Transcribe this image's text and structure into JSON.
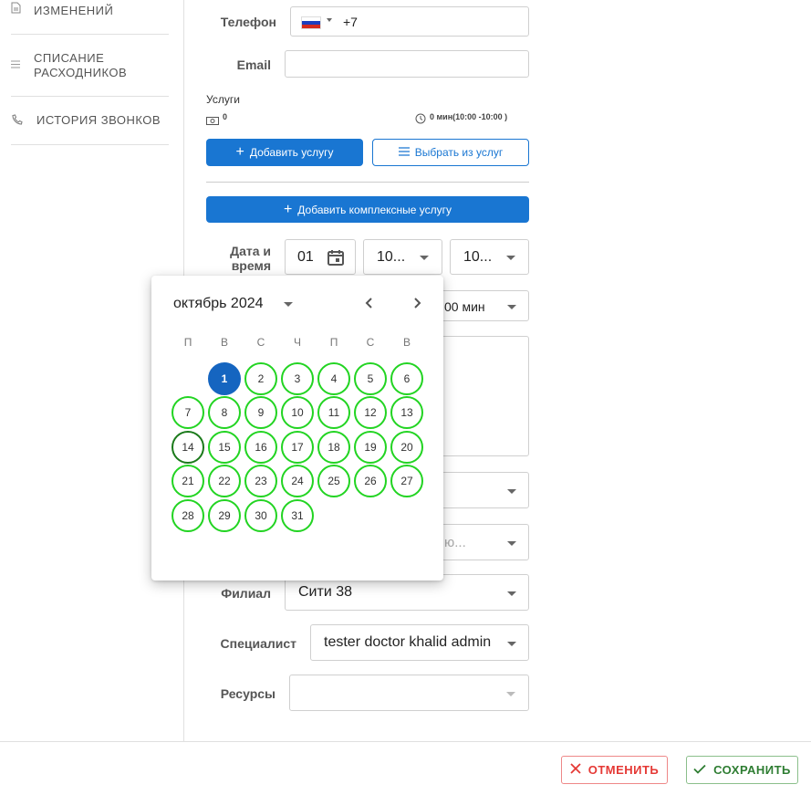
{
  "sidebar": {
    "items": [
      {
        "label": "ИЗМЕНЕНИЙ",
        "icon": "document-icon"
      },
      {
        "label": "СПИСАНИЕ РАСХОДНИКОВ",
        "icon": "list-icon"
      },
      {
        "label": "ИСТОРИЯ ЗВОНКОВ",
        "icon": "phone-icon"
      }
    ]
  },
  "form": {
    "phone_label": "Телефон",
    "phone_prefix": "+7",
    "email_label": "Email",
    "services_label": "Услуги",
    "services_total": "0",
    "services_time": "0 мин(10:00 -10:00 )",
    "add_service": "Добавить услугу",
    "choose_service": "Выбрать из услуг",
    "add_complex": "Добавить комплексные услугу",
    "datetime_label": "Дата и время",
    "date_value": "01",
    "time_start": "10...",
    "time_end": "10...",
    "duration_value": "00 мин",
    "dept_placeholder": "ю...",
    "branch_label": "Филиал",
    "branch_value": "Сити 38",
    "specialist_label": "Специалист",
    "specialist_value": "tester doctor khalid admin",
    "resources_label": "Ресурсы"
  },
  "calendar": {
    "month_label": "октябрь 2024",
    "weekdays": [
      "П",
      "В",
      "С",
      "Ч",
      "П",
      "С",
      "В"
    ],
    "days": [
      "1",
      "2",
      "3",
      "4",
      "5",
      "6",
      "7",
      "8",
      "9",
      "10",
      "11",
      "12",
      "13",
      "14",
      "15",
      "16",
      "17",
      "18",
      "19",
      "20",
      "21",
      "22",
      "23",
      "24",
      "25",
      "26",
      "27",
      "28",
      "29",
      "30",
      "31"
    ],
    "selected_day": "1",
    "today_day": "14",
    "first_weekday_offset": 1,
    "available_color": "#22d422",
    "selected_color": "#1565c0"
  },
  "footer": {
    "cancel_label": "ОТМЕНИТЬ",
    "save_label": "СОХРАНИТЬ",
    "cancel_color": "#e53935",
    "save_color": "#2e7d32"
  }
}
